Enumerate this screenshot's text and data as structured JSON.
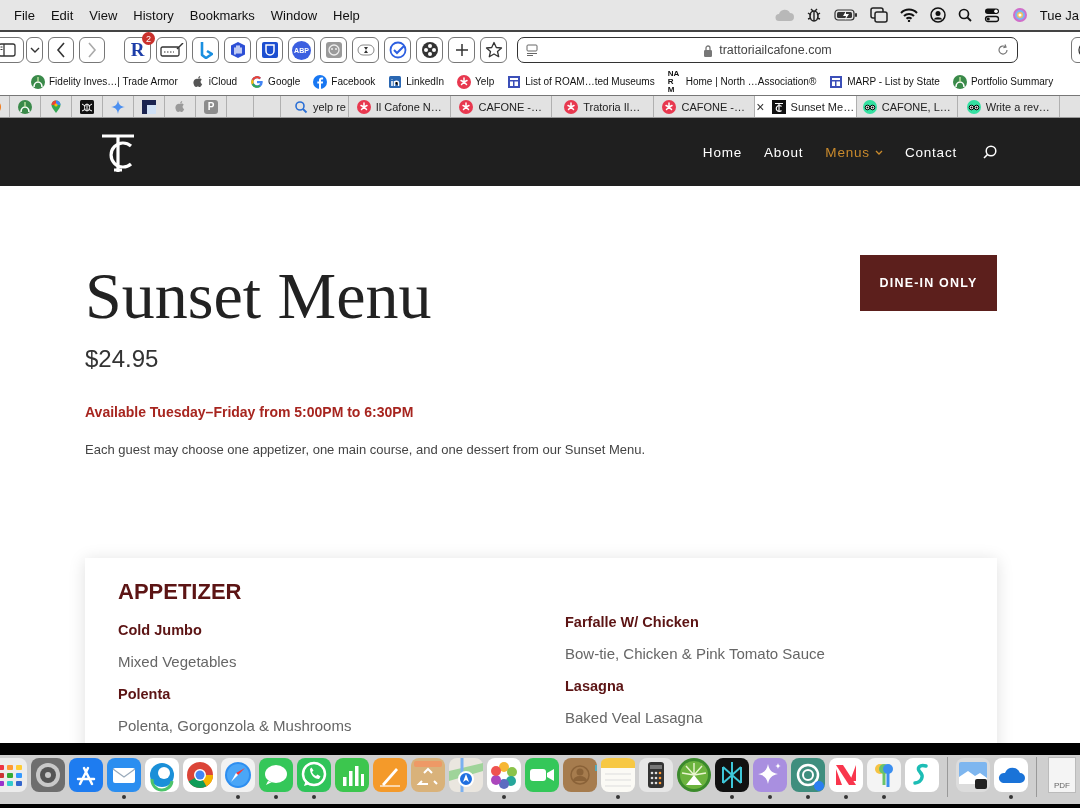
{
  "menu_bar": {
    "items": [
      "File",
      "Edit",
      "View",
      "History",
      "Bookmarks",
      "Window",
      "Help"
    ],
    "clock": "Tue Ja"
  },
  "toolbar": {
    "extensions": [
      {
        "kind": "glyph",
        "glyph": "R",
        "badge": "2"
      },
      {
        "kind": "icon"
      },
      {
        "kind": "icon"
      },
      {
        "kind": "icon"
      },
      {
        "kind": "icon"
      },
      {
        "kind": "glyph",
        "glyph": "ABP"
      },
      {
        "kind": "icon"
      },
      {
        "kind": "icon"
      },
      {
        "kind": "icon"
      },
      {
        "kind": "icon"
      },
      {
        "kind": "icon"
      },
      {
        "kind": "icon"
      }
    ],
    "address": "trattoriailcafone.com"
  },
  "bookmarks": [
    {
      "label": "Fidelity Inves…| Trade Armor"
    },
    {
      "label": "iCloud"
    },
    {
      "label": "Google"
    },
    {
      "label": "Facebook"
    },
    {
      "label": "LinkedIn"
    },
    {
      "label": "Yelp"
    },
    {
      "label": "List of ROAM…ted Museums"
    },
    {
      "label": "Home | North …Association®",
      "glyph": "NARM"
    },
    {
      "label": "MARP - List by State"
    },
    {
      "label": "Portfolio Summary"
    }
  ],
  "tabs": [
    {
      "kind": "pinned",
      "selected": false
    },
    {
      "kind": "pinned",
      "selected": false
    },
    {
      "kind": "pinned",
      "selected": false
    },
    {
      "kind": "pinned",
      "selected": false
    },
    {
      "kind": "pinned",
      "selected": false
    },
    {
      "kind": "pinned",
      "selected": false
    },
    {
      "kind": "pinned",
      "selected": false
    },
    {
      "kind": "pinned",
      "selected": false,
      "glyph": "P"
    },
    {
      "kind": "blank",
      "selected": false
    },
    {
      "kind": "blank",
      "selected": false
    },
    {
      "kind": "page",
      "label": "yelp re",
      "selected": false
    },
    {
      "kind": "page",
      "label": "Il Cafone N…",
      "selected": false
    },
    {
      "kind": "page",
      "label": "CAFONE -…",
      "selected": false
    },
    {
      "kind": "page",
      "label": "Tratoria Il…",
      "selected": false
    },
    {
      "kind": "page",
      "label": "CAFONE -…",
      "selected": false
    },
    {
      "kind": "page",
      "label": "Sunset Me…",
      "selected": true,
      "close": "×"
    },
    {
      "kind": "page",
      "label": "CAFONE, L…",
      "selected": false
    },
    {
      "kind": "page",
      "label": "Write a rev…",
      "selected": false
    }
  ],
  "site_nav": [
    {
      "label": "Home",
      "selected": false
    },
    {
      "label": "About",
      "selected": false
    },
    {
      "label": "Menus",
      "selected": true,
      "submenu": true
    },
    {
      "label": "Contact",
      "selected": false
    }
  ],
  "page": {
    "title": "Sunset Menu",
    "price": "$24.95",
    "availability": "Available Tuesday–Friday from 5:00PM to 6:30PM",
    "description": "Each guest may choose one appetizer, one main course, and one dessert from our Sunset Menu.",
    "badge": "DINE-IN ONLY"
  },
  "menu_card": {
    "heading": "APPETIZER",
    "columns": [
      [
        {
          "name": "Cold Jumbo",
          "description": "Mixed Vegetables"
        },
        {
          "name": "Polenta",
          "description": "Polenta, Gorgonzola & Mushrooms"
        }
      ],
      [
        {
          "name": "Farfalle W/ Chicken",
          "description": "Bow-tie, Chicken & Pink Tomato Sauce"
        },
        {
          "name": "Lasagna",
          "description": "Baked Veal Lasagna"
        }
      ]
    ]
  },
  "dock": [
    {
      "kind": "app",
      "running": false
    },
    {
      "kind": "app",
      "running": false
    },
    {
      "kind": "app",
      "running": false
    },
    {
      "kind": "app",
      "running": true
    },
    {
      "kind": "app",
      "running": false
    },
    {
      "kind": "app",
      "running": false
    },
    {
      "kind": "app",
      "running": true
    },
    {
      "kind": "app",
      "running": true
    },
    {
      "kind": "app",
      "running": true
    },
    {
      "kind": "app",
      "running": false
    },
    {
      "kind": "app",
      "running": false
    },
    {
      "kind": "app",
      "running": false
    },
    {
      "kind": "app",
      "running": false
    },
    {
      "kind": "app",
      "running": true
    },
    {
      "kind": "app",
      "running": false
    },
    {
      "kind": "app",
      "running": false
    },
    {
      "kind": "app",
      "running": true
    },
    {
      "kind": "app",
      "running": false
    },
    {
      "kind": "app",
      "running": false
    },
    {
      "kind": "app",
      "running": true
    },
    {
      "kind": "app",
      "running": true
    },
    {
      "kind": "app",
      "running": true
    },
    {
      "kind": "app",
      "running": true
    },
    {
      "kind": "app",
      "running": true
    },
    {
      "kind": "app",
      "running": false
    },
    {
      "kind": "separator"
    },
    {
      "kind": "app",
      "running": false
    },
    {
      "kind": "app",
      "running": true
    },
    {
      "kind": "separator"
    },
    {
      "kind": "document",
      "label": "PDF"
    }
  ]
}
